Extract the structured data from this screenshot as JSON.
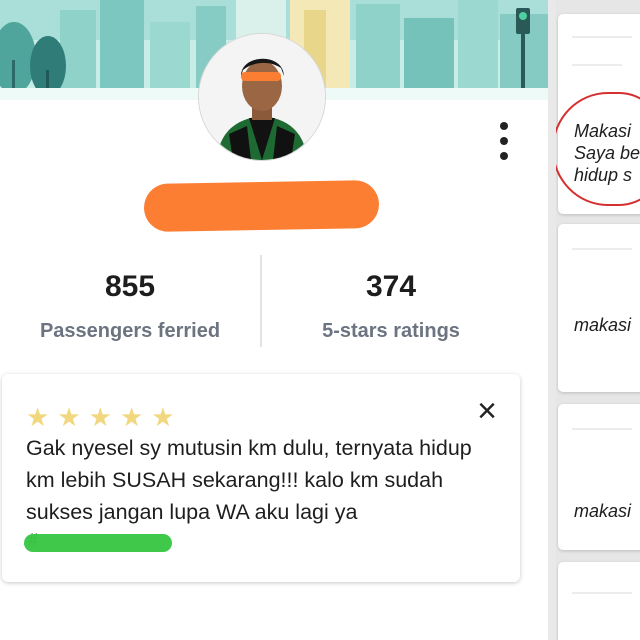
{
  "profile": {
    "stats": [
      {
        "value": "855",
        "label": "Passengers ferried"
      },
      {
        "value": "374",
        "label": "5-stars ratings"
      }
    ]
  },
  "review": {
    "stars": [
      "★",
      "★",
      "★",
      "★",
      "★"
    ],
    "rating": 5,
    "close_icon": "×",
    "text": "Gak nyesel sy mutusin km dulu, ternyata hidup km lebih SUSAH sekarang!!! kalo km sudah sukses jangan lupa WA aku lagi ya",
    "hashtag": "#"
  },
  "side_cards": [
    {
      "lines": [
        "Makasi",
        "Saya be",
        "hidup s"
      ]
    },
    {
      "lines": [
        "makasi"
      ]
    },
    {
      "lines": [
        "makasi"
      ]
    }
  ],
  "colors": {
    "name_redaction": "#fb7e33",
    "hashtag_redaction": "#35c540",
    "star": "#f1d77e",
    "circle_annotation": "#d53030",
    "banner_sky": "#bfe8e2"
  },
  "icons": {
    "more": "vertical-dots-icon",
    "close": "close-icon",
    "star": "star-icon"
  }
}
